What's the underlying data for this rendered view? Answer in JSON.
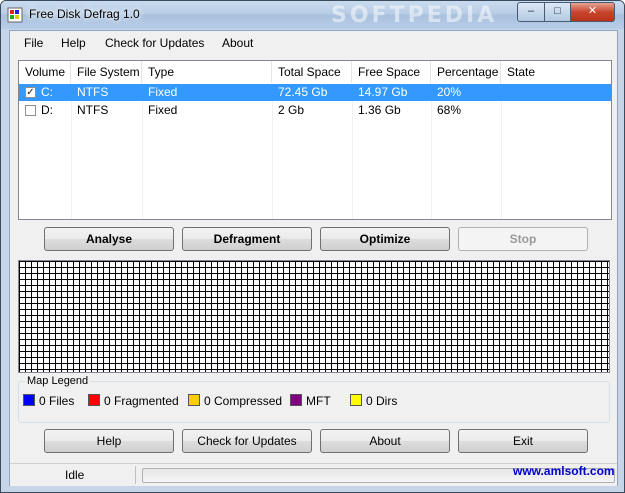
{
  "window": {
    "title": "Free Disk Defrag 1.0",
    "watermark": "SOFTPEDIA"
  },
  "window_controls": {
    "minimize": "–",
    "maximize": "□",
    "close": "✕"
  },
  "menu": [
    "File",
    "Help",
    "Check for Updates",
    "About"
  ],
  "table": {
    "columns": [
      "Volume",
      "File System",
      "Type",
      "Total Space",
      "Free Space",
      "Percentage",
      "State"
    ],
    "rows": [
      {
        "checked": true,
        "selected": true,
        "volume": "C:",
        "file_system": "NTFS",
        "type": "Fixed",
        "total_space": "72.45 Gb",
        "free_space": "14.97 Gb",
        "percentage": "20%",
        "state": ""
      },
      {
        "checked": false,
        "selected": false,
        "volume": "D:",
        "file_system": "NTFS",
        "type": "Fixed",
        "total_space": "2 Gb",
        "free_space": "1.36 Gb",
        "percentage": "68%",
        "state": ""
      }
    ]
  },
  "actions": {
    "analyse": "Analyse",
    "defragment": "Defragment",
    "optimize": "Optimize",
    "stop": "Stop"
  },
  "legend": {
    "title": "Map Legend",
    "items": [
      {
        "label": "0 Files",
        "color": "#0000ff"
      },
      {
        "label": "0 Fragmented",
        "color": "#ff0000"
      },
      {
        "label": "0 Compressed",
        "color": "#ffcc00"
      },
      {
        "label": "MFT",
        "color": "#800080"
      },
      {
        "label": "0 Dirs",
        "color": "#ffff00"
      }
    ]
  },
  "bottom_buttons": {
    "help": "Help",
    "check_updates": "Check for Updates",
    "about": "About",
    "exit": "Exit"
  },
  "status": {
    "text": "Idle",
    "link": "www.amlsoft.com",
    "progress": 0
  },
  "colors": {
    "selection": "#3399ff",
    "link": "#0000cc"
  }
}
